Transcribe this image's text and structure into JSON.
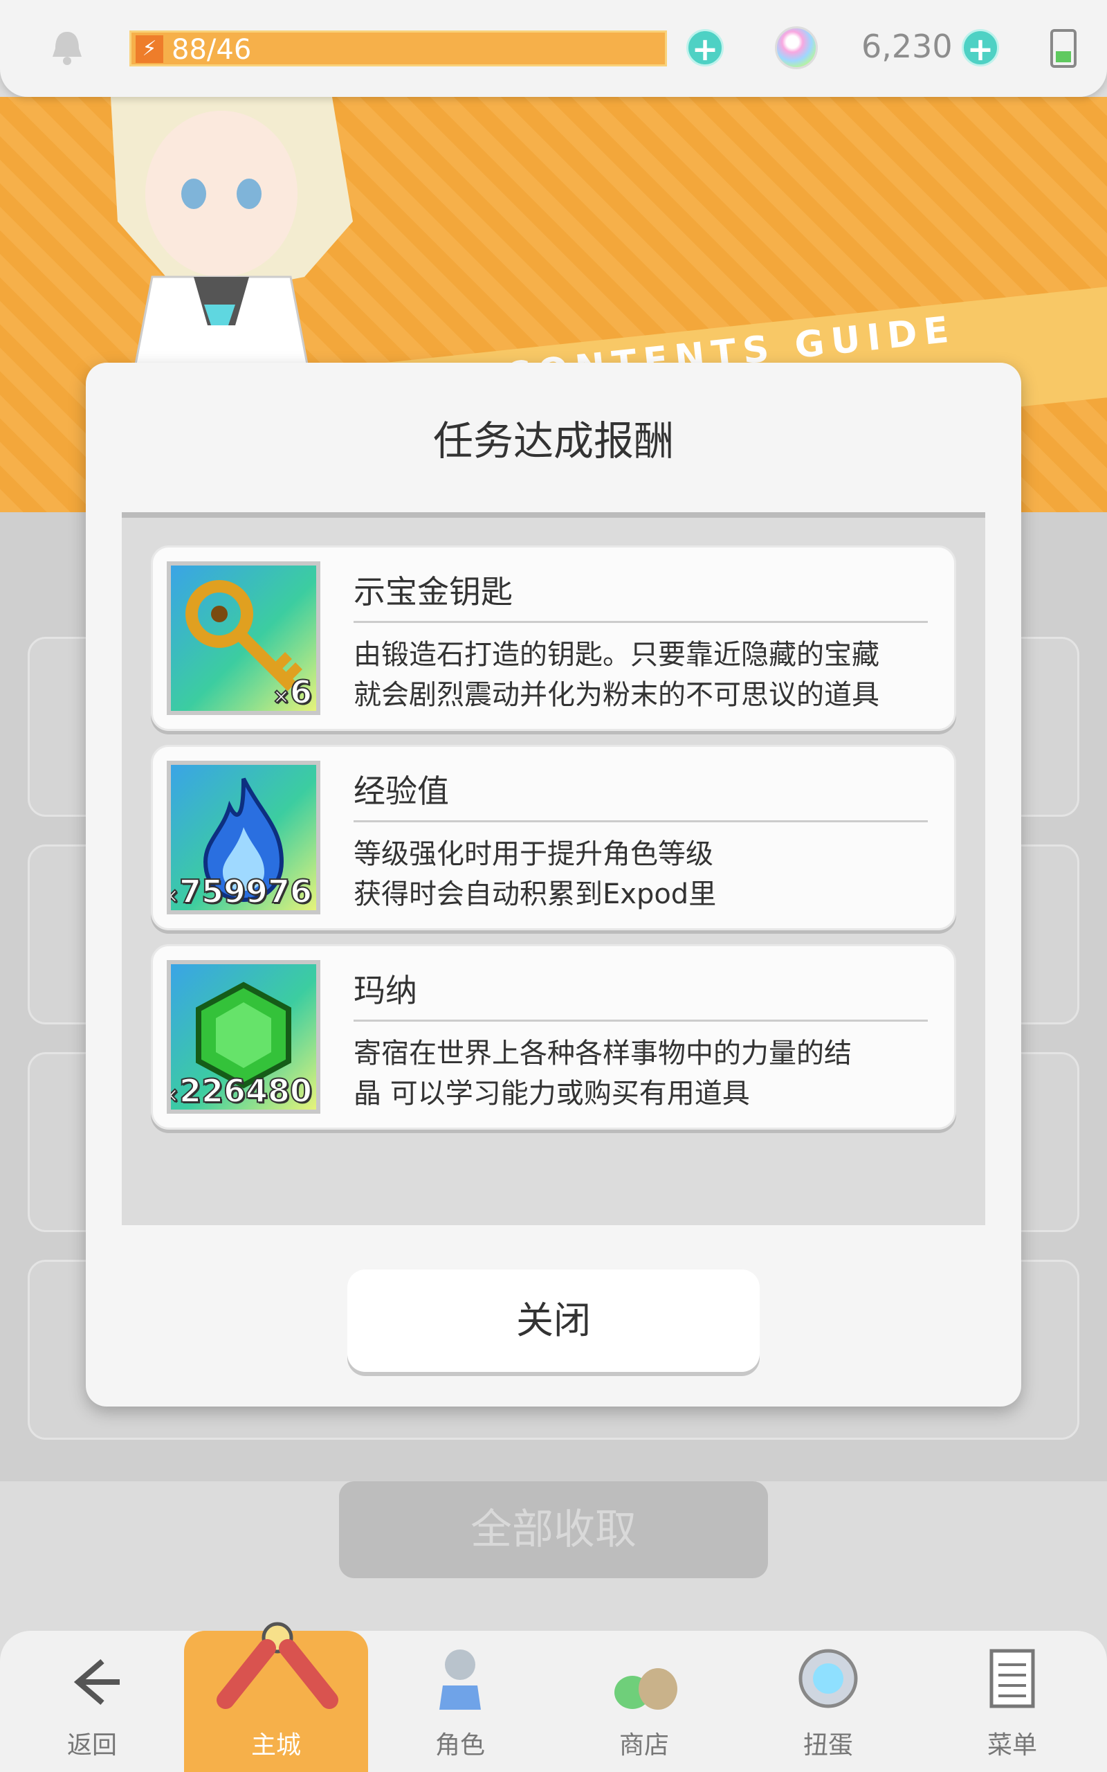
{
  "topbar": {
    "stamina_text": "88/46",
    "gems": "6,230"
  },
  "banner": {
    "guide_en": "CONTENTS GUIDE"
  },
  "background": {
    "collect_all": "全部收取"
  },
  "dialog": {
    "title": "任务达成报酬",
    "items": [
      {
        "name": "示宝金钥匙",
        "qty": "6",
        "desc1": "由锻造石打造的钥匙。只要靠近隐藏的宝藏",
        "desc2": "就会剧烈震动并化为粉末的不可思议的道具",
        "icon": "golden-key-icon"
      },
      {
        "name": "经验值",
        "qty": "759976",
        "desc1": "等级强化时用于提升角色等级",
        "desc2": "获得时会自动积累到Expod里",
        "icon": "blue-flame-icon"
      },
      {
        "name": "玛纳",
        "qty": "226480",
        "desc1": "寄宿在世界上各种各样事物中的力量的结",
        "desc2": "晶 可以学习能力或购买有用道具",
        "icon": "green-gem-icon"
      }
    ],
    "close_label": "关闭"
  },
  "nav": {
    "items": [
      {
        "label": "返回",
        "icon": "back-arrow-icon"
      },
      {
        "label": "主城",
        "icon": "town-icon"
      },
      {
        "label": "角色",
        "icon": "character-icon"
      },
      {
        "label": "商店",
        "icon": "shop-icon"
      },
      {
        "label": "扭蛋",
        "icon": "gacha-icon"
      },
      {
        "label": "菜单",
        "icon": "menu-icon"
      }
    ]
  },
  "colors": {
    "accent_orange": "#f6b04a",
    "teal": "#4ed1c4"
  }
}
